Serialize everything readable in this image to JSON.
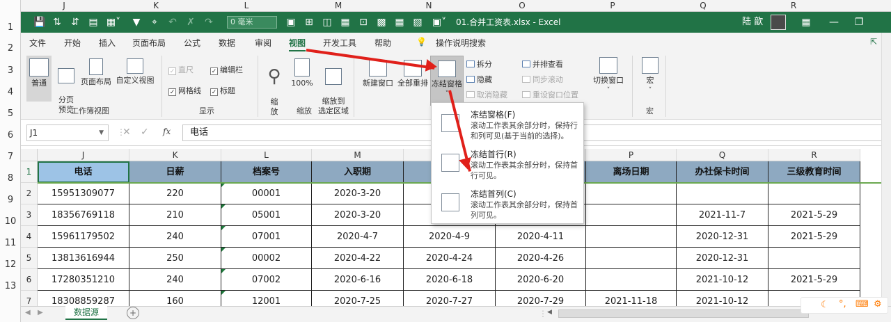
{
  "sheet_col_letters": [
    "J",
    "K",
    "L",
    "M",
    "N",
    "O",
    "P",
    "Q",
    "R"
  ],
  "outer_row_numbers": [
    "1",
    "2",
    "3",
    "4",
    "5",
    "6",
    "7",
    "8",
    "9",
    "10",
    "11",
    "12",
    "13"
  ],
  "title_bar": {
    "zoom_value": "0 毫米",
    "file_title": "01.合并工资表.xlsx  -  Excel",
    "user_name": "陆 歆"
  },
  "tabs": [
    "文件",
    "开始",
    "插入",
    "页面布局",
    "公式",
    "数据",
    "审阅",
    "视图",
    "开发工具",
    "帮助"
  ],
  "active_tab": "视图",
  "tell_me": "操作说明搜索",
  "ribbon": {
    "normal": "普通",
    "page_break": "分页\n预览",
    "page_layout": "页面布局",
    "custom_view": "自定义视图",
    "group_workbook_views": "工作簿视图",
    "ruler": "直尺",
    "formula_bar": "编辑栏",
    "gridlines": "网格线",
    "headings": "标题",
    "group_show": "显示",
    "zoom": "缩\n放",
    "zoom100": "100%",
    "zoom_sel": "缩放到\n选定区域",
    "group_zoom": "缩放",
    "new_window": "新建窗口",
    "arrange_all": "全部重排",
    "freeze": "冻结窗格",
    "split": "拆分",
    "hide": "隐藏",
    "unhide": "取消隐藏",
    "side_by_side": "并排查看",
    "sync_scroll": "同步滚动",
    "reset_pos": "重设窗口位置",
    "switch_windows": "切换窗口",
    "macros": "宏",
    "group_macros": "宏"
  },
  "formula": {
    "name_box": "J1",
    "fx": "fx",
    "value": "电话"
  },
  "grid": {
    "col_letters": [
      "J",
      "K",
      "L",
      "M",
      "N",
      "O",
      "P",
      "Q",
      "R"
    ],
    "row_numbers": [
      "1",
      "2",
      "3",
      "4",
      "5",
      "6",
      "7"
    ],
    "headers": [
      "电话",
      "日薪",
      "档案号",
      "入职期",
      "",
      "",
      "离场日期",
      "办社保卡时间",
      "三级教育时间"
    ],
    "rows": [
      [
        "15951309077",
        "220",
        "00001",
        "2020-3-20",
        "2",
        "",
        "",
        "",
        ""
      ],
      [
        "18356769118",
        "210",
        "05001",
        "2020-3-20",
        "2",
        "",
        "",
        "2021-11-7",
        "2021-5-29"
      ],
      [
        "15961179502",
        "240",
        "07001",
        "2020-4-7",
        "2020-4-9",
        "2020-4-11",
        "",
        "2020-12-31",
        "2021-5-29"
      ],
      [
        "13813616944",
        "250",
        "00002",
        "2020-4-22",
        "2020-4-24",
        "2020-4-26",
        "",
        "2020-12-31",
        ""
      ],
      [
        "17280351210",
        "240",
        "07002",
        "2020-6-16",
        "2020-6-18",
        "2020-6-20",
        "",
        "2021-10-12",
        "2021-5-29"
      ],
      [
        "18308859287",
        "160",
        "12001",
        "2020-7-25",
        "2020-7-27",
        "2020-7-29",
        "2021-11-18",
        "2021-10-12",
        "20"
      ]
    ]
  },
  "dropdown": [
    {
      "title": "冻结窗格(F)",
      "desc": "滚动工作表其余部分时，保持行和列可见(基于当前的选择)。"
    },
    {
      "title": "冻结首行(R)",
      "desc": "滚动工作表其余部分时，保持首行可见。"
    },
    {
      "title": "冻结首列(C)",
      "desc": "滚动工作表其余部分时，保持首列可见。"
    }
  ],
  "sheet_tab": "数据源",
  "add_sheet": "+",
  "accent": "#217346",
  "header_fill": "#8ea9c1",
  "arrow_color": "#e0201a"
}
